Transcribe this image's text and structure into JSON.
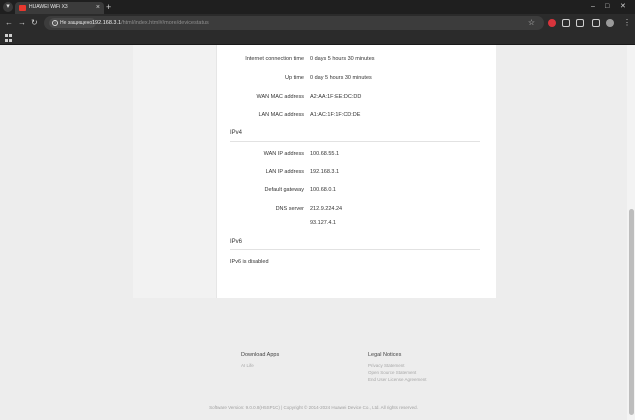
{
  "browser": {
    "tab_title": "HUAWEI WiFi X3",
    "security_chip": "Не защищено",
    "url_host": "192.168.3.1",
    "url_path": "/html/index.html#/more/devicestatus"
  },
  "status": {
    "rows_top": [
      {
        "label": "Internet connection time",
        "value": "0 days 5 hours 30 minutes"
      },
      {
        "label": "Up time",
        "value": "0 day 5 hours 30 minutes"
      },
      {
        "label": "WAN MAC address",
        "value": "A2:AA:1F:EE:DC:DD"
      },
      {
        "label": "LAN MAC address",
        "value": "A1:AC:1F:1F:CD:DE"
      }
    ],
    "ipv4_title": "IPv4",
    "ipv4_rows": [
      {
        "label": "WAN IP address",
        "value": "100.68.55.1"
      },
      {
        "label": "LAN IP address",
        "value": "192.168.3.1"
      },
      {
        "label": "Default gateway",
        "value": "100.68.0.1"
      },
      {
        "label": "DNS server",
        "value": "212.9.224.24"
      },
      {
        "label": "",
        "value": "93.127.4.1"
      }
    ],
    "ipv6_title": "IPv6",
    "ipv6_text": "IPv6 is disabled"
  },
  "footer": {
    "download_title": "Download Apps",
    "download_links": [
      "AI Life"
    ],
    "legal_title": "Legal Notices",
    "legal_links": [
      "Privacy Statement",
      "Open Source Statement",
      "End User License Agreement"
    ],
    "copyright": "Software Version: 9.0.0.8(H5SP1C) | Copyright © 2014-2024 Huawei Device Co., Ltd. All rights reserved."
  }
}
